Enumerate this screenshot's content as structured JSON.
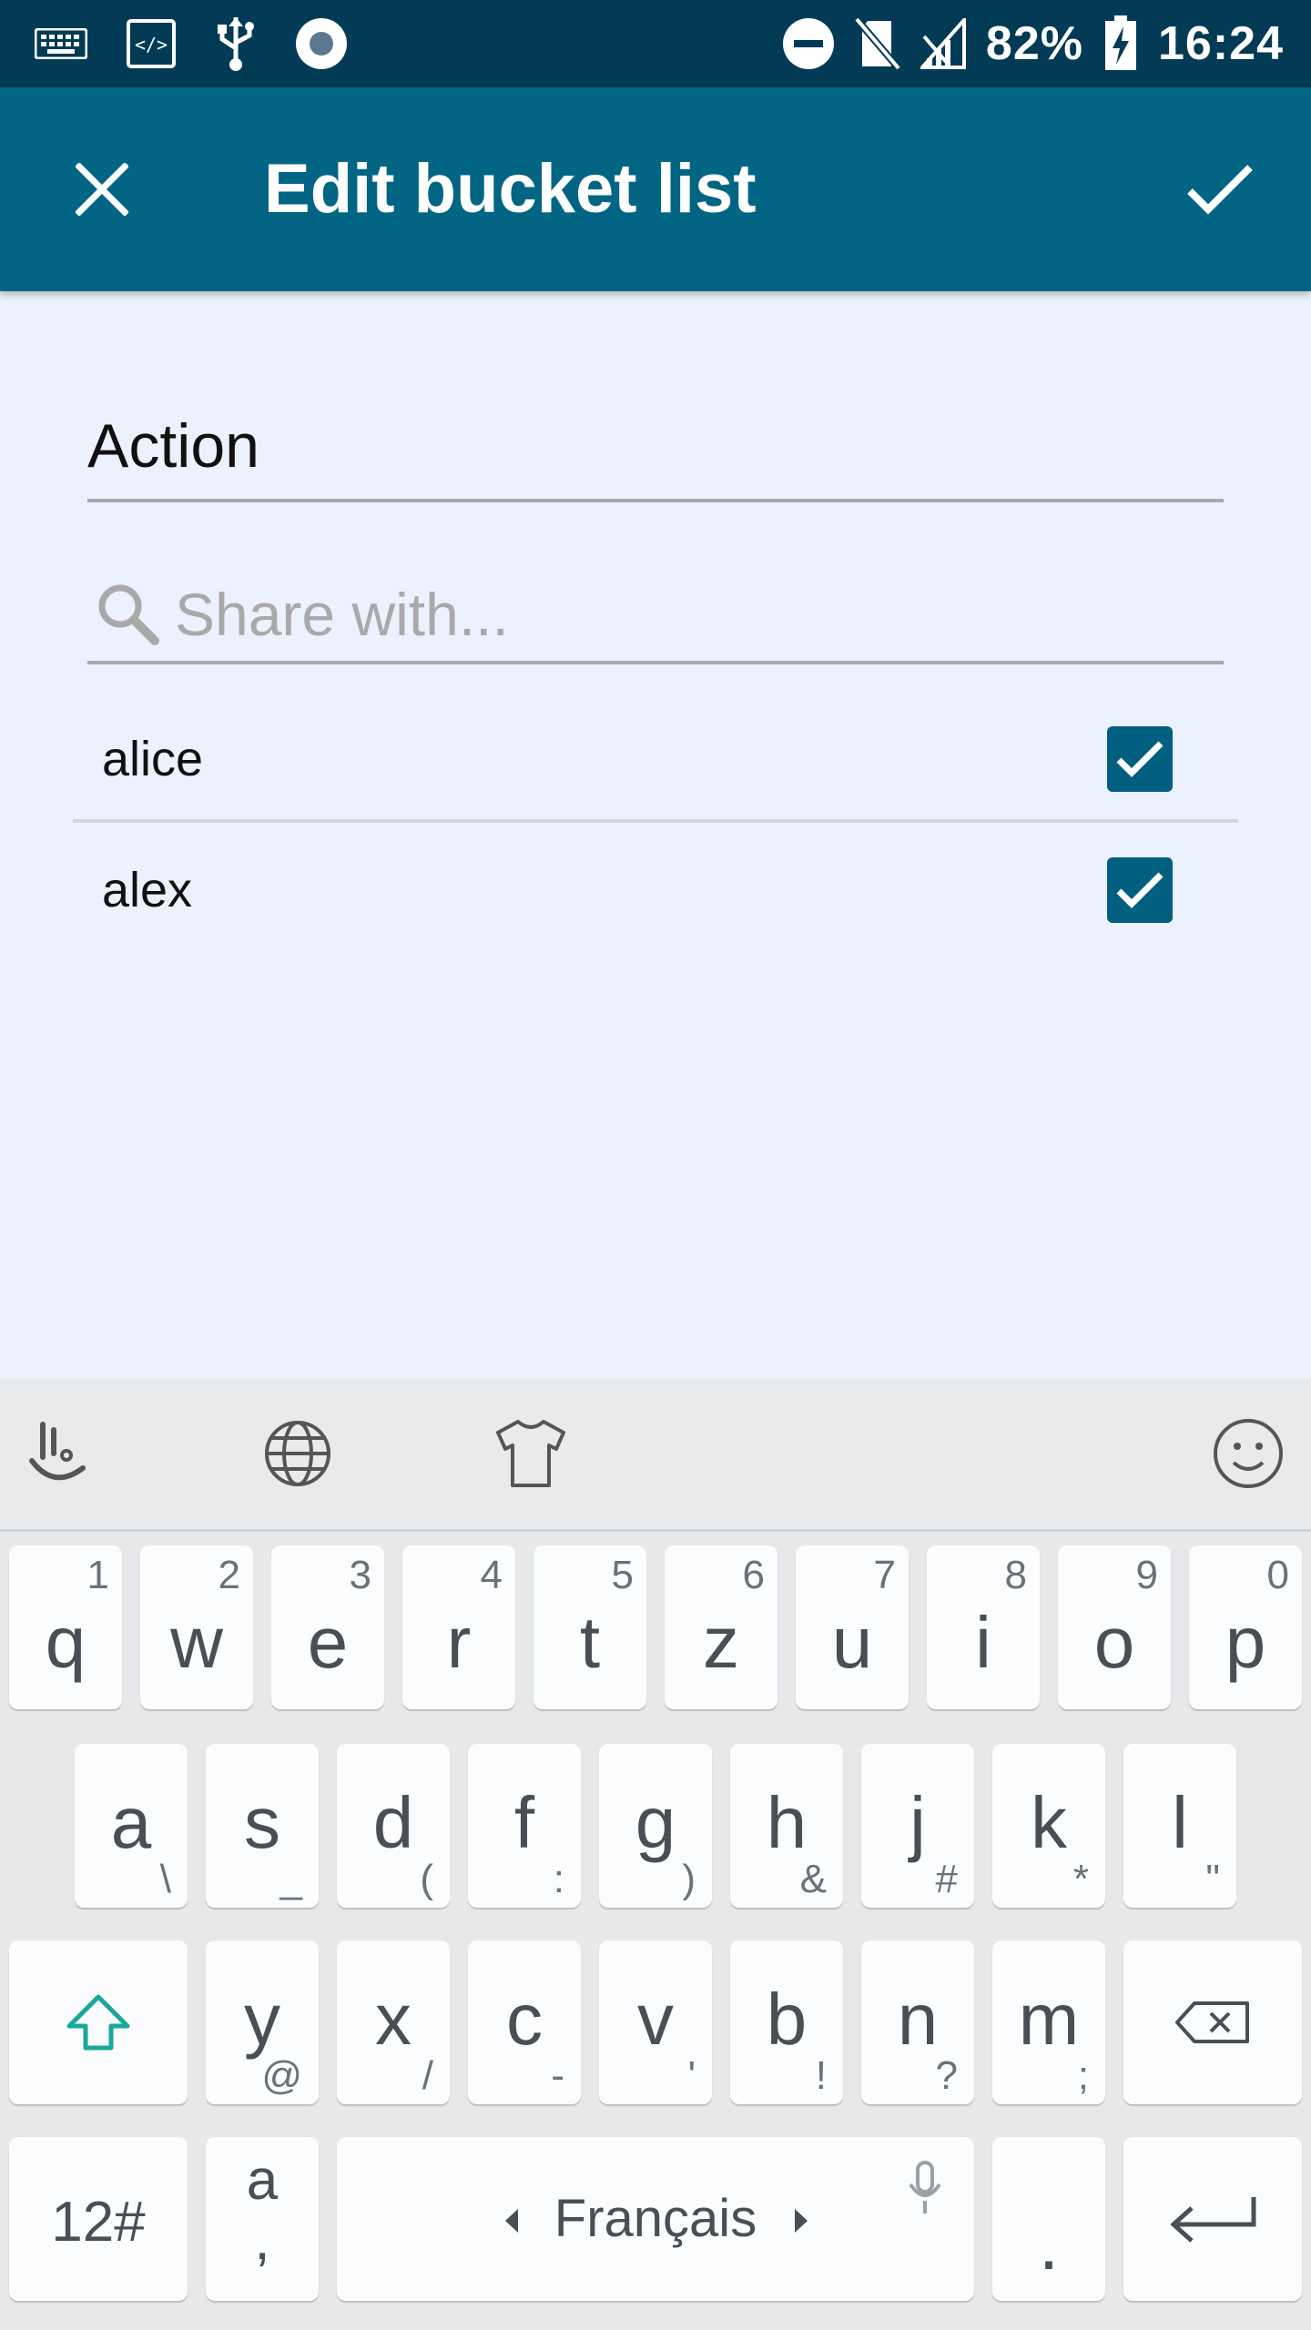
{
  "status_bar": {
    "battery_percent": "82%",
    "time": "16:24"
  },
  "app_bar": {
    "title": "Edit bucket list"
  },
  "form": {
    "name_value": "Action",
    "share_placeholder": "Share with..."
  },
  "share_list": [
    {
      "name": "alice",
      "checked": true
    },
    {
      "name": "alex",
      "checked": true
    }
  ],
  "keyboard": {
    "row1": [
      {
        "main": "q",
        "sup": "1"
      },
      {
        "main": "w",
        "sup": "2"
      },
      {
        "main": "e",
        "sup": "3"
      },
      {
        "main": "r",
        "sup": "4"
      },
      {
        "main": "t",
        "sup": "5"
      },
      {
        "main": "z",
        "sup": "6"
      },
      {
        "main": "u",
        "sup": "7"
      },
      {
        "main": "i",
        "sup": "8"
      },
      {
        "main": "o",
        "sup": "9"
      },
      {
        "main": "p",
        "sup": "0"
      }
    ],
    "row2": [
      {
        "main": "a",
        "sub": "\\"
      },
      {
        "main": "s",
        "sub": "_"
      },
      {
        "main": "d",
        "sub": "("
      },
      {
        "main": "f",
        "sub": ":"
      },
      {
        "main": "g",
        "sub": ")"
      },
      {
        "main": "h",
        "sub": "&"
      },
      {
        "main": "j",
        "sub": "#"
      },
      {
        "main": "k",
        "sub": "*"
      },
      {
        "main": "l",
        "sub": "\""
      }
    ],
    "row3": [
      {
        "main": "y",
        "sub": "@"
      },
      {
        "main": "x",
        "sub": "/"
      },
      {
        "main": "c",
        "sub": "-"
      },
      {
        "main": "v",
        "sub": "'"
      },
      {
        "main": "b",
        "sub": "!"
      },
      {
        "main": "n",
        "sub": "?"
      },
      {
        "main": "m",
        "sub": ";"
      }
    ],
    "symbols_label": "12#",
    "punct_top": "a",
    "punct_bottom": ",",
    "space_label": "Français",
    "period_label": "."
  }
}
